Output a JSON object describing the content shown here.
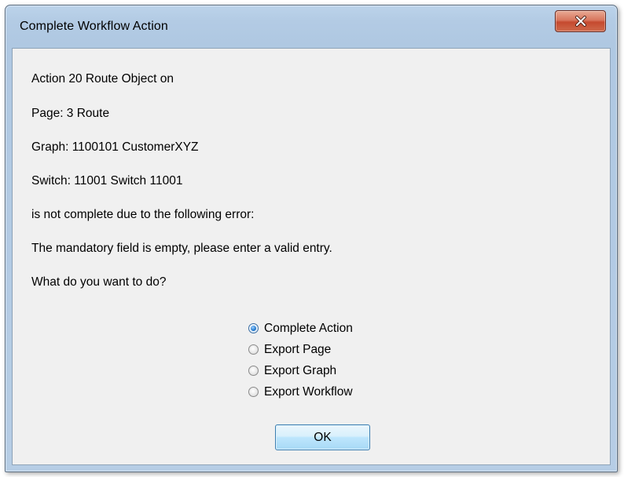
{
  "window": {
    "title": "Complete Workflow Action",
    "close_icon": "close-x-icon",
    "close_button_color": "#c54a2f"
  },
  "message": {
    "lines": [
      "Action 20  Route Object on",
      "Page: 3 Route",
      "Graph: 1100101 CustomerXYZ",
      "Switch: 11001 Switch 11001",
      "is not complete due to the following error:",
      "The mandatory field is empty, please enter a valid entry.",
      "What do you want to do?"
    ]
  },
  "options": {
    "items": [
      {
        "label": "Complete Action",
        "checked": true
      },
      {
        "label": "Export Page",
        "checked": false
      },
      {
        "label": "Export Graph",
        "checked": false
      },
      {
        "label": "Export Workflow",
        "checked": false
      }
    ]
  },
  "buttons": {
    "ok_label": "OK"
  }
}
